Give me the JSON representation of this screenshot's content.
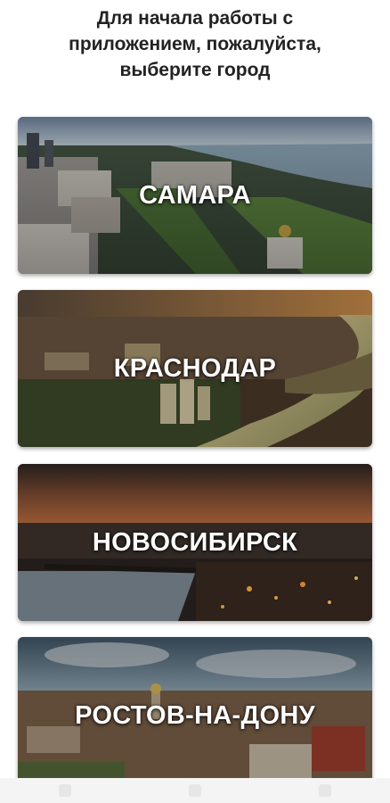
{
  "header": {
    "line1": "Для начала работы с",
    "line2": "приложением, пожалуйста,",
    "line3": "выберите город"
  },
  "cities": [
    {
      "name": "САМАРА"
    },
    {
      "name": "КРАСНОДАР"
    },
    {
      "name": "НОВОСИБИРСК"
    },
    {
      "name": "РОСТОВ-НА-ДОНУ"
    }
  ]
}
